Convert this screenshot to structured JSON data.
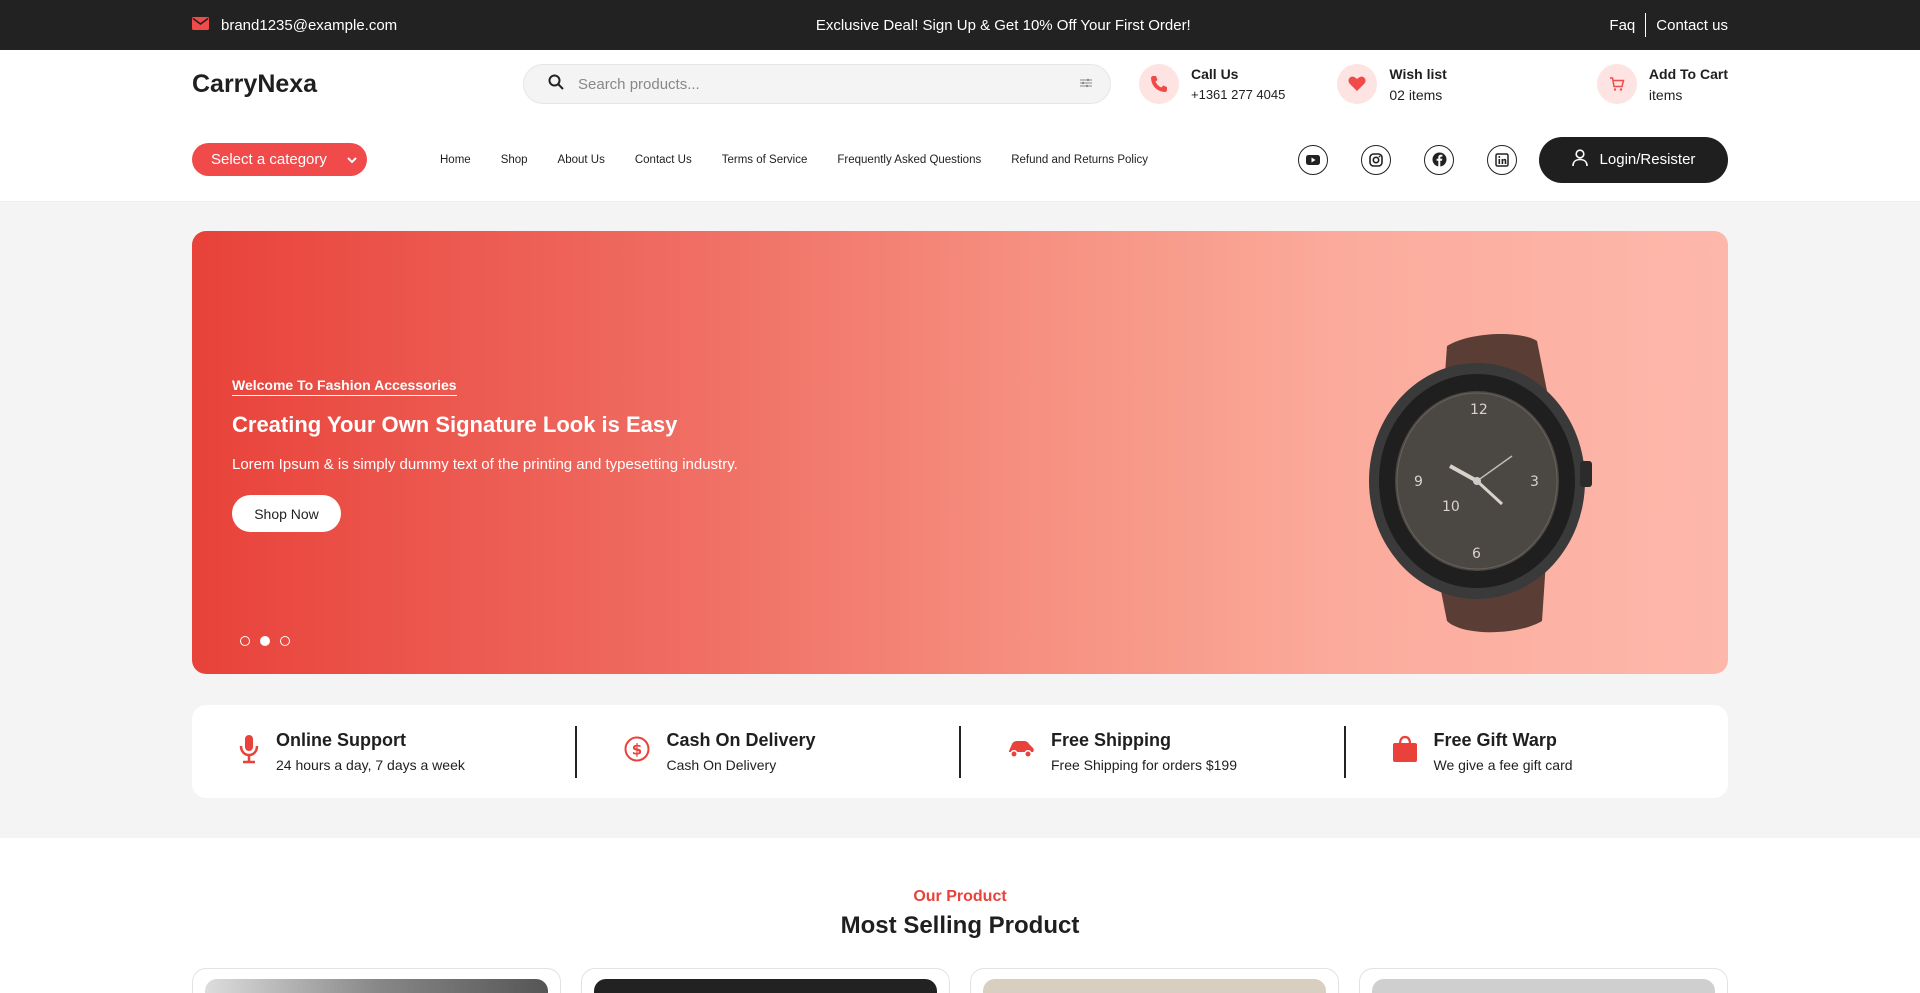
{
  "topbar": {
    "email": "brand1235@example.com",
    "promo": "Exclusive Deal! Sign Up & Get 10% Off Your First Order!",
    "links": [
      "Faq",
      "Contact us"
    ]
  },
  "header": {
    "logo": "CarryNexa",
    "search_placeholder": "Search products...",
    "call": {
      "title": "Call Us",
      "value": "+1361 277 4045"
    },
    "wishlist": {
      "title": "Wish list",
      "value": "02 items"
    },
    "cart": {
      "title": "Add To Cart",
      "value": "items"
    }
  },
  "nav": {
    "category_select": "Select a category",
    "items": [
      "Home",
      "Shop",
      "About Us",
      "Contact Us",
      "Terms of Service",
      "Frequently Asked Questions",
      "Refund and Returns Policy"
    ],
    "social_icons": [
      "youtube-icon",
      "instagram-icon",
      "facebook-icon",
      "linkedin-icon"
    ],
    "login_label": "Login/Resister"
  },
  "hero": {
    "subtitle": "Welcome To Fashion Accessories",
    "title": "Creating Your Own Signature Look is Easy",
    "description": "Lorem Ipsum & is simply dummy text of the printing and typesetting industry.",
    "button": "Shop Now",
    "slides": 3,
    "active_slide": 2
  },
  "features": [
    {
      "icon": "microphone-icon",
      "title": "Online Support",
      "subtitle": "24 hours a day, 7 days a week"
    },
    {
      "icon": "dollar-icon",
      "title": "Cash On Delivery",
      "subtitle": "Cash On Delivery"
    },
    {
      "icon": "car-icon",
      "title": "Free Shipping",
      "subtitle": "Free Shipping for orders $199"
    },
    {
      "icon": "gift-bag-icon",
      "title": "Free Gift Warp",
      "subtitle": "We give a fee gift card"
    }
  ],
  "products": {
    "label": "Our Product",
    "heading": "Most Selling Product"
  },
  "colors": {
    "accent": "#e8423a",
    "dark": "#222222",
    "accent_light": "#fde3e1"
  }
}
